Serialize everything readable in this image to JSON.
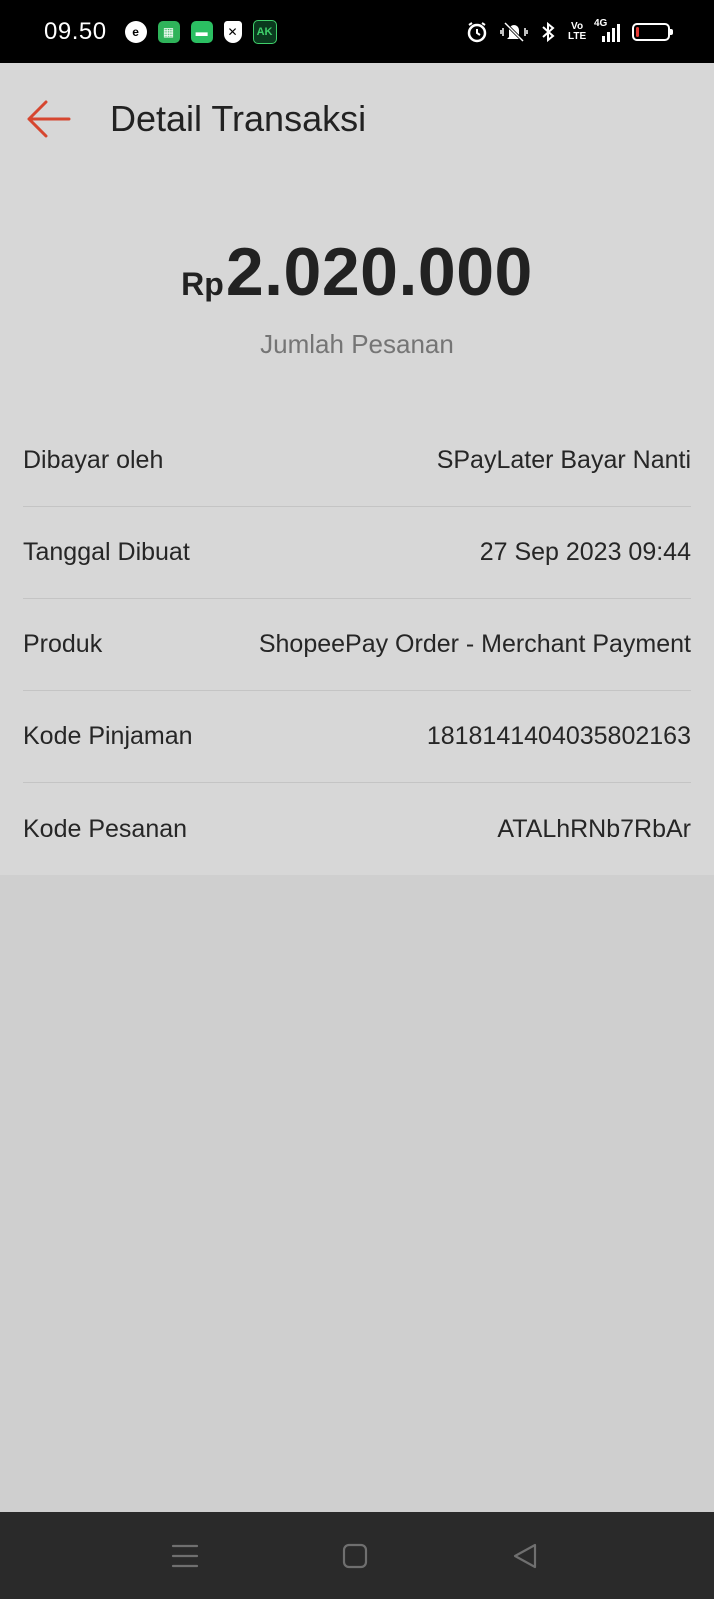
{
  "status_bar": {
    "time": "09.50",
    "notification_icons": [
      "chrome-like-icon",
      "calculator-app-icon",
      "chat-app-icon",
      "shield-icon",
      "ak-app-icon"
    ],
    "system_icons": [
      "alarm-icon",
      "mute-vibrate-icon",
      "bluetooth-icon",
      "volte-icon",
      "4g-signal-icon",
      "battery-icon"
    ],
    "volte_label": "Vo LTE",
    "network_label": "4G",
    "battery_level": 0.1,
    "battery_color": "#e53935"
  },
  "header": {
    "title": "Detail Transaksi",
    "back_icon": "arrow-left-icon",
    "accent_color": "#d6462f"
  },
  "summary": {
    "currency": "Rp",
    "amount": "2.020.000",
    "label": "Jumlah Pesanan"
  },
  "details": [
    {
      "label": "Dibayar oleh",
      "value": "SPayLater Bayar Nanti"
    },
    {
      "label": "Tanggal Dibuat",
      "value": "27 Sep 2023 09:44"
    },
    {
      "label": "Produk",
      "value": "ShopeePay Order - Merchant Payment"
    },
    {
      "label": "Kode Pinjaman",
      "value": "1818141404035802163"
    },
    {
      "label": "Kode Pesanan",
      "value": "ATALhRNb7RbAr"
    }
  ],
  "nav_bar": {
    "buttons": [
      "menu-icon",
      "home-square-icon",
      "back-triangle-icon"
    ]
  }
}
